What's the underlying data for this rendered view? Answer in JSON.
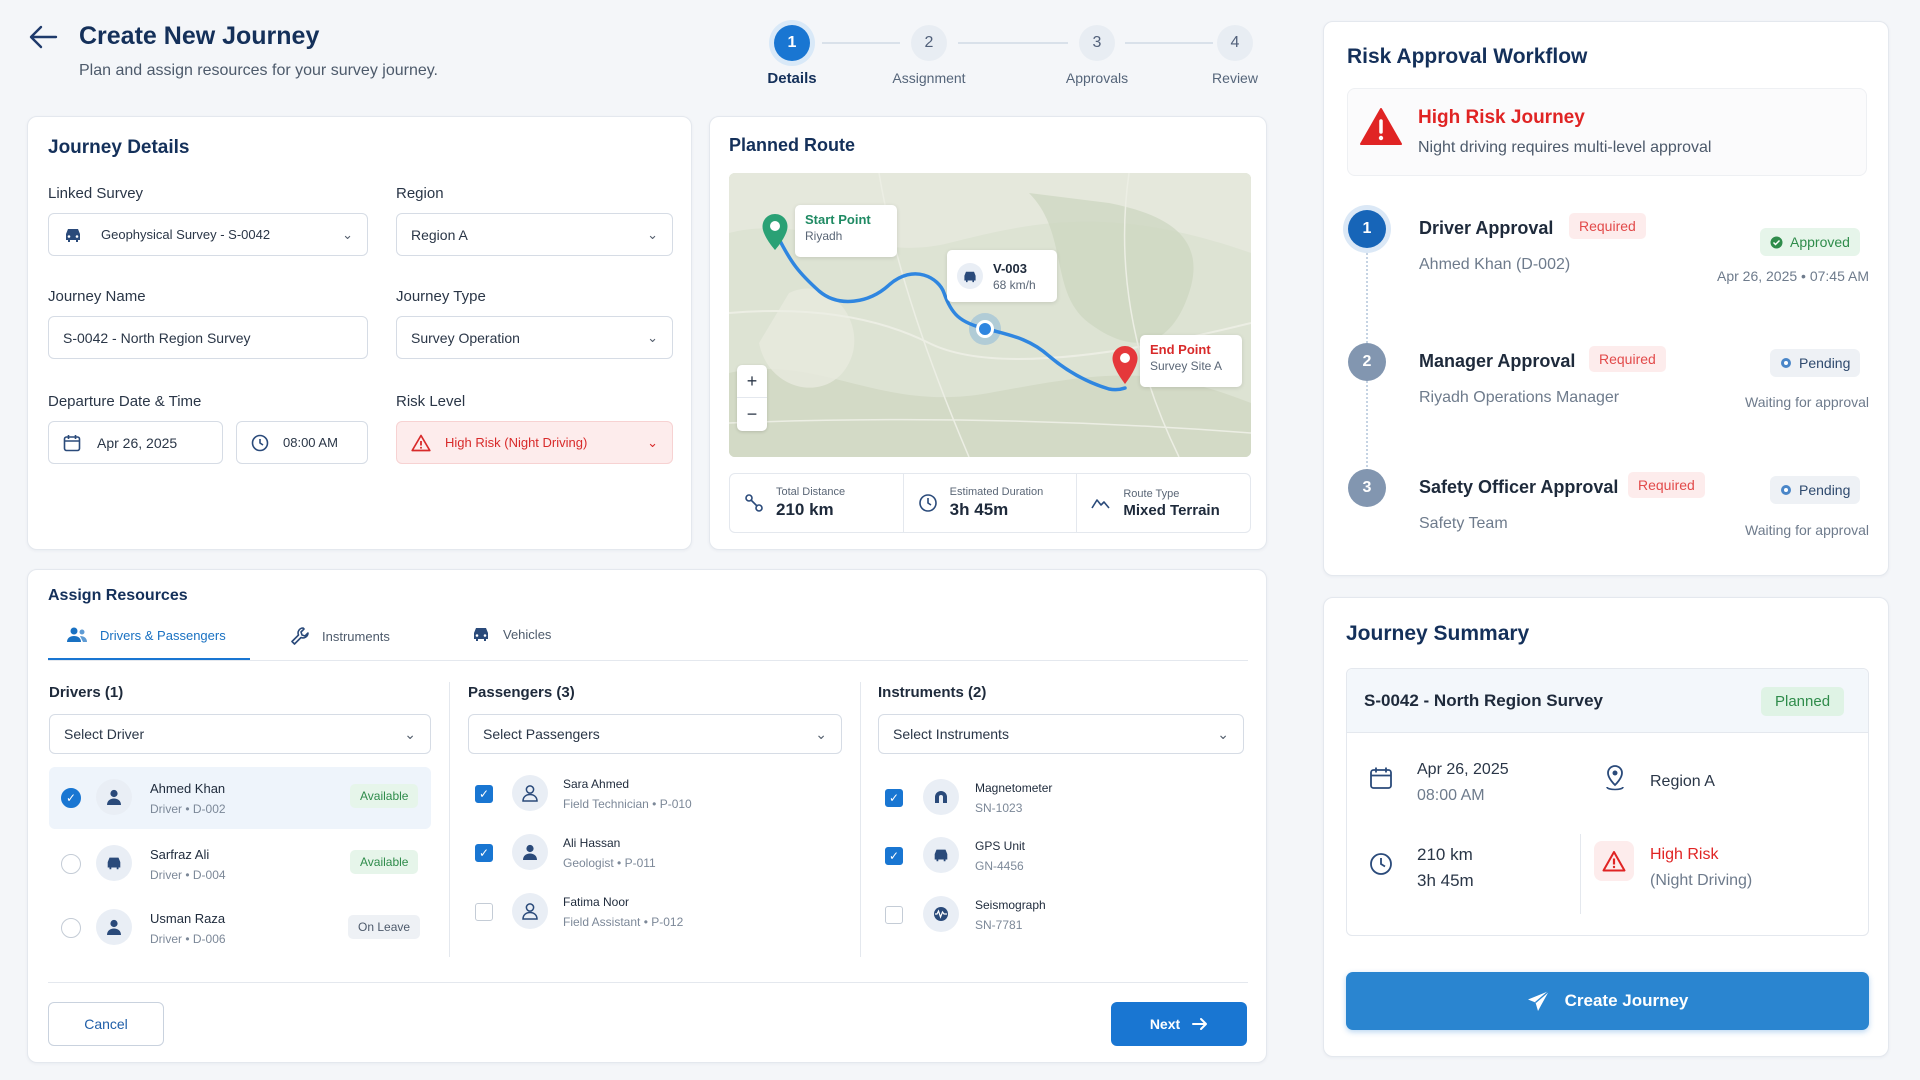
{
  "header": {
    "title": "Create New Journey",
    "subtitle": "Plan and assign resources for your survey journey."
  },
  "stepper": [
    {
      "num": "1",
      "label": "Details"
    },
    {
      "num": "2",
      "label": "Assignment"
    },
    {
      "num": "3",
      "label": "Approvals"
    },
    {
      "num": "4",
      "label": "Review"
    }
  ],
  "details": {
    "title": "Journey Details",
    "linked_survey_label": "Linked Survey",
    "linked_survey_value": "Geophysical Survey - S-0042",
    "region_label": "Region",
    "region_value": "Region A",
    "journey_name_label": "Journey Name",
    "journey_name_value": "S-0042 - North Region Survey",
    "journey_type_label": "Journey Type",
    "journey_type_value": "Survey Operation",
    "departure_label": "Departure Date & Time",
    "date_value": "Apr 26, 2025",
    "time_value": "08:00 AM",
    "risk_label": "Risk Level",
    "risk_value": "High Risk (Night Driving)"
  },
  "route": {
    "title": "Planned Route",
    "start_title": "Start Point",
    "start_sub": "Riyadh",
    "vehicle_title": "V-003",
    "vehicle_speed": "68 km/h",
    "end_title": "End Point",
    "end_sub": "Survey Site A",
    "zoom_in": "+",
    "zoom_out": "−",
    "stats": [
      {
        "label": "Total Distance",
        "value": "210 km"
      },
      {
        "label": "Estimated Duration",
        "value": "3h 45m"
      },
      {
        "label": "Route Type",
        "value": "Mixed Terrain"
      }
    ]
  },
  "resources": {
    "title": "Assign Resources",
    "tabs": [
      "Drivers & Passengers",
      "Instruments",
      "Vehicles"
    ],
    "drivers_header": "Drivers (1)",
    "drivers_select": "Select Driver",
    "drivers": [
      {
        "name": "Ahmed Khan",
        "sub": "Driver • D-002",
        "status": "Available"
      },
      {
        "name": "Sarfraz Ali",
        "sub": "Driver • D-004",
        "status": "Available"
      },
      {
        "name": "Usman Raza",
        "sub": "Driver • D-006",
        "status": "On Leave"
      }
    ],
    "passengers_header": "Passengers (3)",
    "passengers_select": "Select Passengers",
    "passengers": [
      {
        "name": "Sara Ahmed",
        "sub": "Field Technician • P-010"
      },
      {
        "name": "Ali Hassan",
        "sub": "Geologist • P-011"
      },
      {
        "name": "Fatima Noor",
        "sub": "Field Assistant • P-012"
      }
    ],
    "instruments_header": "Instruments (2)",
    "instruments_select": "Select Instruments",
    "instruments": [
      {
        "name": "Magnetometer",
        "sub": "SN-1023"
      },
      {
        "name": "GPS Unit",
        "sub": "GN-4456"
      },
      {
        "name": "Seismograph",
        "sub": "SN-7781"
      }
    ],
    "cancel": "Cancel",
    "next": "Next"
  },
  "workflow": {
    "title": "Risk Approval Workflow",
    "alert_title": "High Risk Journey",
    "alert_sub": "Night driving requires multi-level approval",
    "steps": [
      {
        "num": "1",
        "title": "Driver Approval",
        "tag": "Required",
        "sub": "Ahmed Khan (D-002)",
        "status": "Approved",
        "time": "Apr 26, 2025 • 07:45 AM"
      },
      {
        "num": "2",
        "title": "Manager Approval",
        "tag": "Required",
        "sub": "Riyadh Operations Manager",
        "status": "Pending",
        "time": "Waiting for approval"
      },
      {
        "num": "3",
        "title": "Safety Officer Approval",
        "tag": "Required",
        "sub": "Safety Team",
        "status": "Pending",
        "time": "Waiting for approval"
      }
    ]
  },
  "summary": {
    "title": "Journey Summary",
    "name": "S-0042 - North Region Survey",
    "status": "Planned",
    "date": "Apr 26, 2025",
    "time": "08:00 AM",
    "region": "Region A",
    "distance": "210 km",
    "duration": "3h 45m",
    "risk": "High Risk",
    "risk_sub": "(Night Driving)",
    "create": "Create Journey"
  },
  "colors": {
    "accent": "#1976d2",
    "danger": "#e02424",
    "success": "#2f8c4b"
  }
}
